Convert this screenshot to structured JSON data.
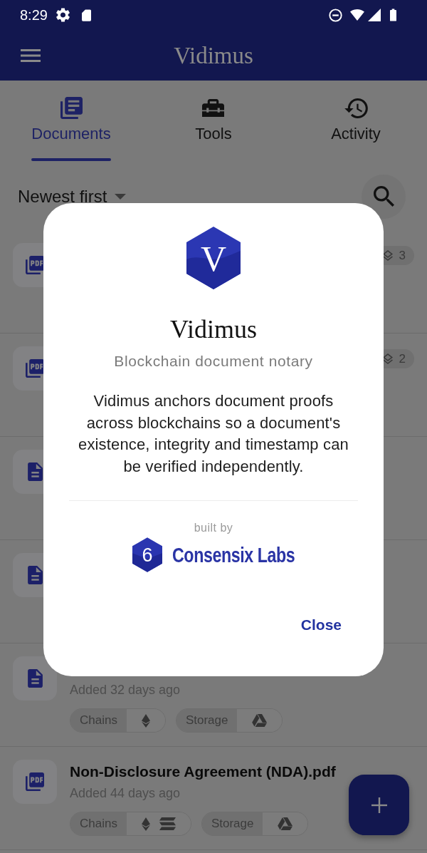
{
  "status_bar": {
    "time": "8:29"
  },
  "app_bar": {
    "title": "Vidimus"
  },
  "tabs": [
    {
      "label": "Documents",
      "selected": true
    },
    {
      "label": "Tools",
      "selected": false
    },
    {
      "label": "Activity",
      "selected": false
    }
  ],
  "sort": {
    "label": "Newest first"
  },
  "documents": [
    {
      "kind": "pdf",
      "badge": "3"
    },
    {
      "kind": "pdf",
      "badge": "2"
    },
    {
      "kind": "text"
    },
    {
      "kind": "text"
    },
    {
      "kind": "text",
      "added": "Added 32 days ago",
      "chips": [
        {
          "label": "Chains",
          "icons": [
            {
              "kind": "diamond"
            }
          ]
        },
        {
          "label": "Storage",
          "icons": [
            {
              "kind": "triangle"
            }
          ]
        }
      ]
    },
    {
      "kind": "pdf",
      "title": "Non-Disclosure Agreement (NDA).pdf",
      "added": "Added 44 days ago",
      "chips": [
        {
          "label": "Chains",
          "icons": [
            {
              "kind": "diamond"
            },
            {
              "kind": "stripes"
            }
          ]
        },
        {
          "label": "Storage",
          "icons": [
            {
              "kind": "triangle"
            }
          ]
        }
      ]
    }
  ],
  "dialog": {
    "logo_letter": "V",
    "title": "Vidimus",
    "subtitle": "Blockchain document notary",
    "body": "Vidimus anchors document proofs across blockchains so a document's existence, integrity and timestamp can be verified independently.",
    "credit_label": "built by",
    "credit_logo_mark": "6",
    "credit_name": "Consensix Labs",
    "close_button": "Close"
  }
}
